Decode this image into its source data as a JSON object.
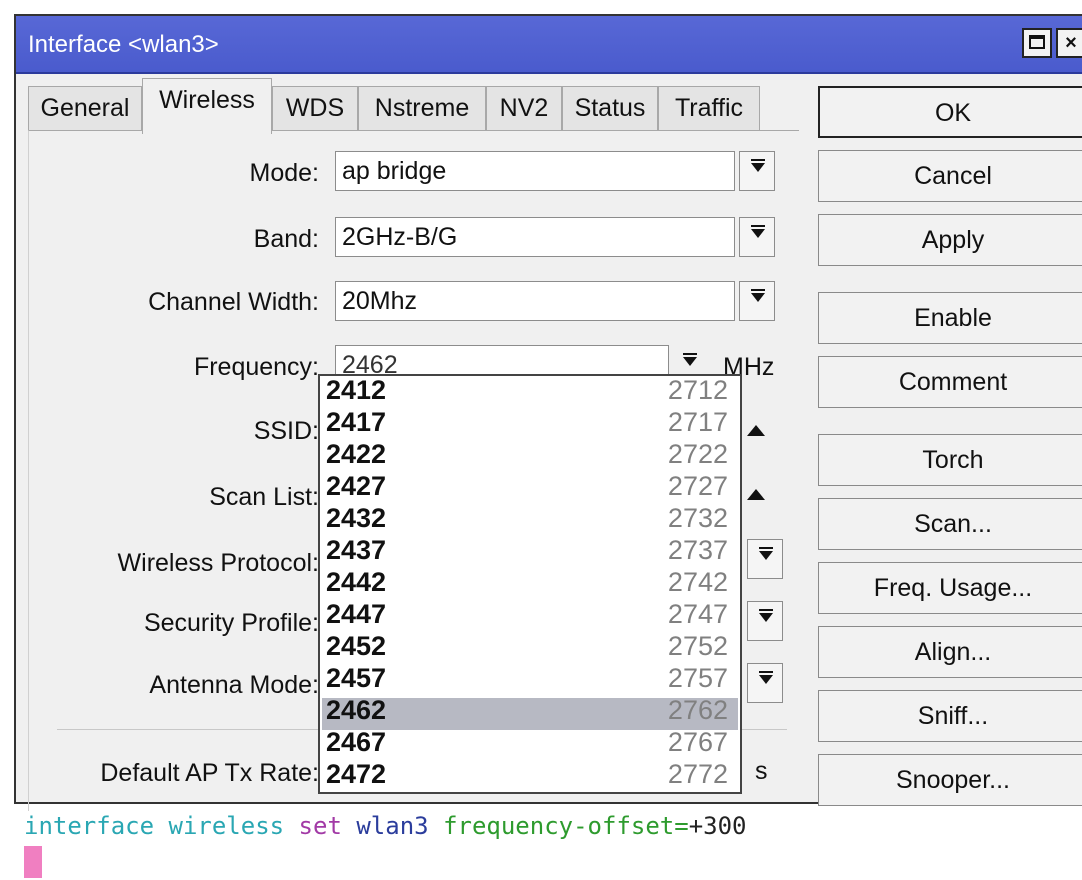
{
  "window": {
    "title": "Interface <wlan3>"
  },
  "tabs": [
    "General",
    "Wireless",
    "WDS",
    "Nstreme",
    "NV2",
    "Status",
    "Traffic"
  ],
  "active_tab": "Wireless",
  "fields": {
    "mode": {
      "label": "Mode:",
      "value": "ap bridge"
    },
    "band": {
      "label": "Band:",
      "value": "2GHz-B/G"
    },
    "channel_width": {
      "label": "Channel Width:",
      "value": "20Mhz"
    },
    "frequency": {
      "label": "Frequency:",
      "value": "2462",
      "unit": "MHz"
    },
    "ssid": {
      "label": "SSID:"
    },
    "scan_list": {
      "label": "Scan List:"
    },
    "wireless_protocol": {
      "label": "Wireless Protocol:"
    },
    "security_profile": {
      "label": "Security Profile:"
    },
    "antenna_mode": {
      "label": "Antenna Mode:"
    },
    "default_ap_tx_rate": {
      "label": "Default AP Tx Rate:",
      "unit_partial": "s"
    }
  },
  "frequency_list": [
    {
      "freq": "2412",
      "offset": "2712"
    },
    {
      "freq": "2417",
      "offset": "2717"
    },
    {
      "freq": "2422",
      "offset": "2722"
    },
    {
      "freq": "2427",
      "offset": "2727"
    },
    {
      "freq": "2432",
      "offset": "2732"
    },
    {
      "freq": "2437",
      "offset": "2737"
    },
    {
      "freq": "2442",
      "offset": "2742"
    },
    {
      "freq": "2447",
      "offset": "2747"
    },
    {
      "freq": "2452",
      "offset": "2752"
    },
    {
      "freq": "2457",
      "offset": "2757"
    },
    {
      "freq": "2462",
      "offset": "2762"
    },
    {
      "freq": "2467",
      "offset": "2767"
    },
    {
      "freq": "2472",
      "offset": "2772"
    }
  ],
  "selected_frequency": "2462",
  "buttons": [
    "OK",
    "Cancel",
    "Apply",
    "Enable",
    "Comment",
    "Torch",
    "Scan...",
    "Freq. Usage...",
    "Align...",
    "Sniff...",
    "Snooper..."
  ],
  "terminal": {
    "w1": "interface",
    "w2": "wireless",
    "w3": "set",
    "w4": "wlan3",
    "w5": "frequency-offset=",
    "w6": "+300"
  },
  "colors": {
    "titlebar": "#4a5bcd",
    "selected_row": "#b7b9c3",
    "cursor": "#f07fc1"
  }
}
